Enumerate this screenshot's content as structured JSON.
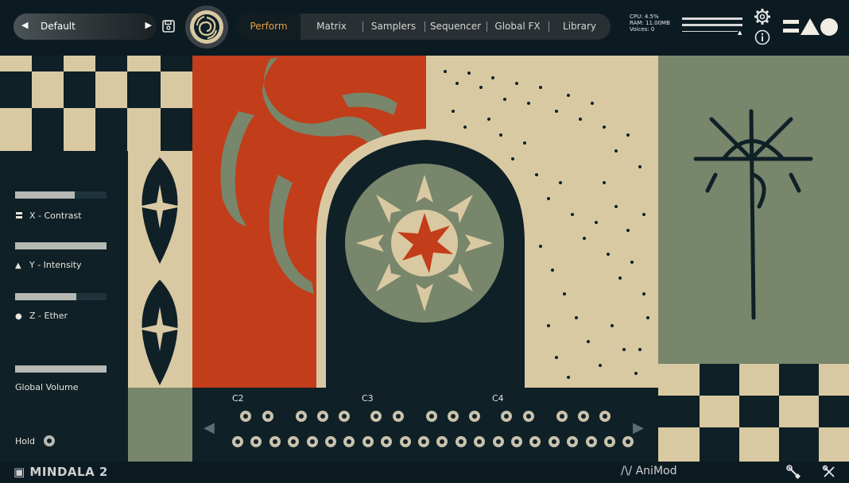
{
  "header": {
    "preset_name": "Default",
    "tabs": [
      {
        "label": "Perform",
        "active": true
      },
      {
        "label": "Matrix",
        "active": false
      },
      {
        "label": "Samplers",
        "active": false
      },
      {
        "label": "Sequencer",
        "active": false
      },
      {
        "label": "Global FX",
        "active": false
      },
      {
        "label": "Library",
        "active": false
      }
    ],
    "stats": {
      "cpu": "CPU: 4.5%",
      "ram": "RAM: 11.00MB",
      "voices": "Voices: 0"
    }
  },
  "controls": {
    "x_label": "X - Contrast",
    "x_value": 0.65,
    "y_label": "Y - Intensity",
    "y_value": 1.0,
    "z_label": "Z - Ether",
    "z_value": 0.67,
    "global_volume_label": "Global Volume",
    "global_volume_value": 1.0,
    "hold_label": "Hold"
  },
  "keyboard": {
    "octave_labels": [
      "C2",
      "C3",
      "C4"
    ]
  },
  "footer": {
    "product": "MINDALA 2",
    "animod": "AniMod"
  },
  "colors": {
    "accent": "#e59f42",
    "dark": "#0f2027",
    "cream": "#d9c9a2",
    "sage": "#78866b",
    "rust": "#c23d1a"
  },
  "icons": {
    "save": "save-icon",
    "settings": "gear-icon",
    "info": "info-icon",
    "tools": [
      "wrench-icon",
      "tools-off-icon"
    ]
  }
}
